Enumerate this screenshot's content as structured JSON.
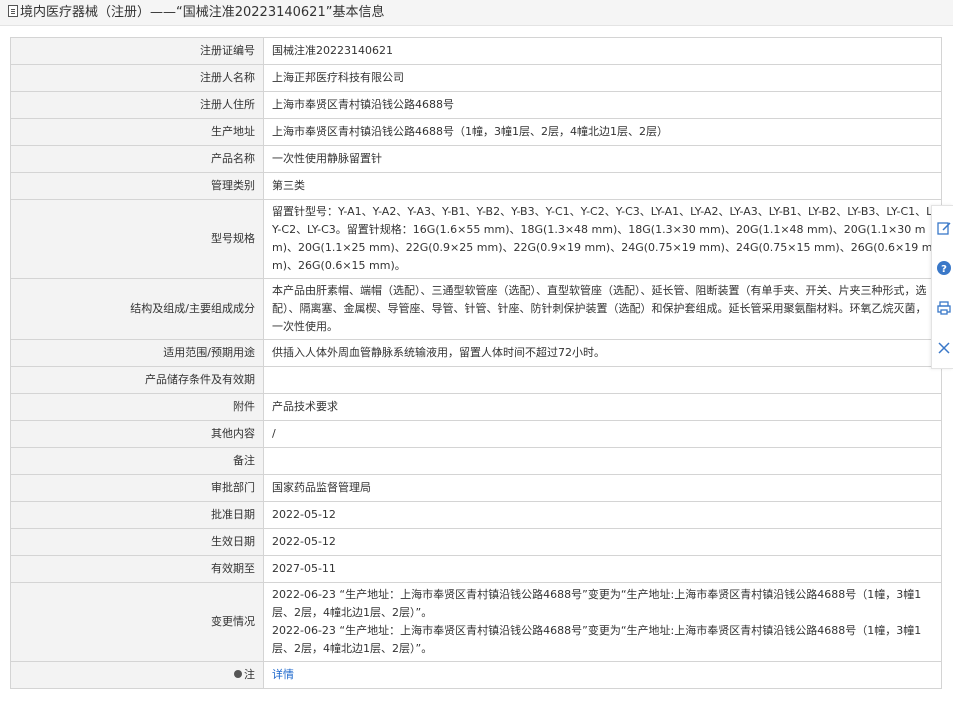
{
  "header": {
    "title": "境内医疗器械（注册）——“国械注准20223140621”基本信息"
  },
  "rows": [
    {
      "label": "注册证编号",
      "value": "国械注准20223140621"
    },
    {
      "label": "注册人名称",
      "value": "上海正邦医疗科技有限公司"
    },
    {
      "label": "注册人住所",
      "value": "上海市奉贤区青村镇沿钱公路4688号"
    },
    {
      "label": "生产地址",
      "value": "上海市奉贤区青村镇沿钱公路4688号（1幢，3幢1层、2层，4幢北边1层、2层）"
    },
    {
      "label": "产品名称",
      "value": "一次性使用静脉留置针"
    },
    {
      "label": "管理类别",
      "value": "第三类"
    },
    {
      "label": "型号规格",
      "value": "留置针型号：Y-A1、Y-A2、Y-A3、Y-B1、Y-B2、Y-B3、Y-C1、Y-C2、Y-C3、LY-A1、LY-A2、LY-A3、LY-B1、LY-B2、LY-B3、LY-C1、LY-C2、LY-C3。留置针规格：16G(1.6×55 mm)、18G(1.3×48 mm)、18G(1.3×30 mm)、20G(1.1×48 mm)、20G(1.1×30 mm)、20G(1.1×25 mm)、22G(0.9×25 mm)、22G(0.9×19 mm)、24G(0.75×19 mm)、24G(0.75×15 mm)、26G(0.6×19 mm)、26G(0.6×15 mm)。"
    },
    {
      "label": "结构及组成/主要组成成分",
      "value": "本产品由肝素帽、端帽（选配）、三通型软管座（选配）、直型软管座（选配）、延长管、阻断装置（有单手夹、开关、片夹三种形式，选配）、隔离塞、金属楔、导管座、导管、针管、针座、防针刺保护装置（选配）和保护套组成。延长管采用聚氨酯材料。环氧乙烷灭菌，一次性使用。"
    },
    {
      "label": "适用范围/预期用途",
      "value": "供插入人体外周血管静脉系统输液用，留置人体时间不超过72小时。"
    },
    {
      "label": "产品储存条件及有效期",
      "value": ""
    },
    {
      "label": "附件",
      "value": "产品技术要求"
    },
    {
      "label": "其他内容",
      "value": "/"
    },
    {
      "label": "备注",
      "value": ""
    },
    {
      "label": "审批部门",
      "value": "国家药品监督管理局"
    },
    {
      "label": "批准日期",
      "value": "2022-05-12"
    },
    {
      "label": "生效日期",
      "value": "2022-05-12"
    },
    {
      "label": "有效期至",
      "value": "2027-05-11"
    }
  ],
  "changes": {
    "label": "变更情况",
    "entries": [
      "2022-06-23 “生产地址：上海市奉贤区青村镇沿钱公路4688号”变更为“生产地址:上海市奉贤区青村镇沿钱公路4688号（1幢，3幢1层、2层，4幢北边1层、2层）”。",
      "2022-06-23 “生产地址：上海市奉贤区青村镇沿钱公路4688号”变更为“生产地址:上海市奉贤区青村镇沿钱公路4688号（1幢，3幢1层、2层，4幢北边1层、2层）”。"
    ]
  },
  "note": {
    "label": "注",
    "link": "详情",
    "icon": "note-dot-icon"
  },
  "side_tools": [
    "edit-icon",
    "help-icon",
    "print-icon",
    "close-icon"
  ],
  "colors": {
    "label_bg": "#f3f3f3",
    "border": "#d4d4d4",
    "link": "#1a66cc",
    "side_icon": "#3a78c8"
  }
}
